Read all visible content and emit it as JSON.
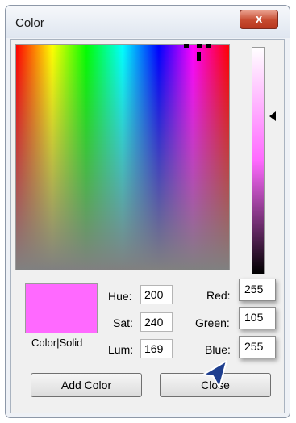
{
  "window": {
    "title": "Color",
    "close_glyph": "x"
  },
  "color_picker": {
    "selected_color": "#ff69ff",
    "swatch_label": "Color|Solid"
  },
  "hsl": {
    "hue_label": "Hue:",
    "hue": "200",
    "sat_label": "Sat:",
    "sat": "240",
    "lum_label": "Lum:",
    "lum": "169"
  },
  "rgb": {
    "red_label": "Red:",
    "red": "255",
    "green_label": "Green:",
    "green": "105",
    "blue_label": "Blue:",
    "blue": "255"
  },
  "buttons": {
    "add_color": "Add Color",
    "close": "Close"
  },
  "icons": [
    "close-icon",
    "crosshair-icon",
    "arrow-pointer-icon",
    "mouse-cursor-icon"
  ]
}
